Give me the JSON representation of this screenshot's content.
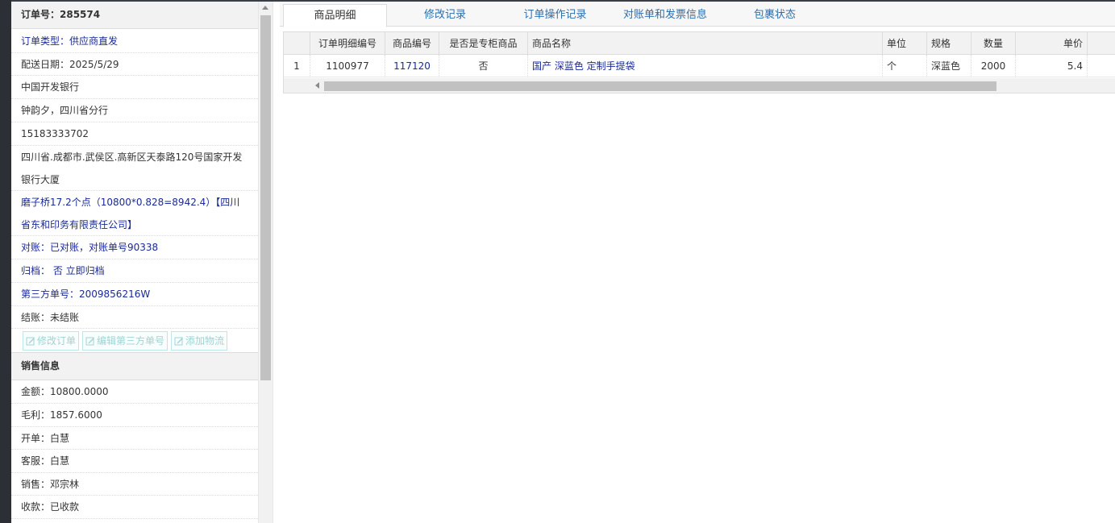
{
  "order": {
    "number_label": "订单号：285574",
    "type_label": "订单类型：",
    "type_value": "供应商直发",
    "delivery_date": "配送日期：2025/5/29",
    "customer_org": "中国开发银行",
    "contact": "钟韵夕，四川省分行",
    "phone": "15183333702",
    "address": "四川省.成都市.武侯区.高新区天泰路120号国家开发银行大厦",
    "supplier_info": "磨子桥17.2个点（10800*0.828=8942.4）【四川省东和印务有限责任公司】",
    "reconcile": "对账：已对账，对账单号90338",
    "archive": "归档： 否 立即归档",
    "third_party": "第三方单号：2009856216W",
    "settle": "结账：未结账"
  },
  "actions": {
    "edit_order": "修改订单",
    "edit_third_party": "编辑第三方单号",
    "add_logistics": "添加物流"
  },
  "sales": {
    "header": "销售信息",
    "amount": "金额：10800.0000",
    "gross_profit": "毛利：1857.6000",
    "issuer": "开单：白慧",
    "service": "客服：白慧",
    "sales_person": "销售：邓宗林",
    "payment": "收款：已收款"
  },
  "tabs": [
    {
      "label": "商品明细",
      "active": true
    },
    {
      "label": "修改记录",
      "active": false
    },
    {
      "label": "订单操作记录",
      "active": false
    },
    {
      "label": "对账单和发票信息",
      "active": false
    },
    {
      "label": "包裹状态",
      "active": false
    }
  ],
  "grid": {
    "columns": [
      "订单明细编号",
      "商品编号",
      "是否是专柜商品",
      "商品名称",
      "单位",
      "规格",
      "数量",
      "单价"
    ],
    "rows": [
      {
        "index": "1",
        "detail_id": "1100977",
        "product_id": "117120",
        "is_counter": "否",
        "product_name": "国产 深蓝色 定制手提袋",
        "unit": "个",
        "spec": "深蓝色",
        "quantity": "2000",
        "price": "5.4"
      }
    ]
  },
  "colors": {
    "link_blue": "#1a2a99",
    "tab_blue": "#2a6fb0",
    "button_teal": "#9fd3d3"
  }
}
